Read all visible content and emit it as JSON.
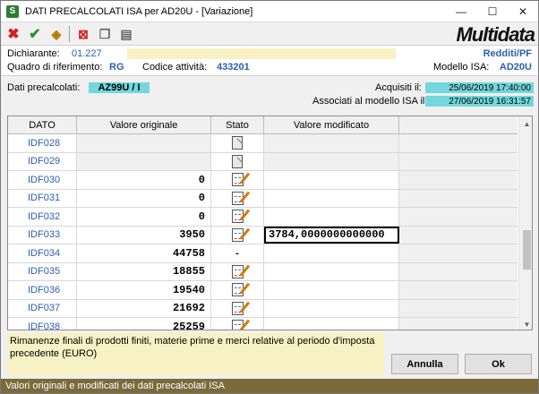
{
  "window": {
    "title": "DATI PRECALCOLATI ISA per AD20U - [Variazione]",
    "app_icon_letter": "S",
    "minimize": "—",
    "maximize": "☐",
    "close": "✕"
  },
  "toolbar": {
    "logo": "Multidata"
  },
  "header": {
    "dichiarante_label": "Dichiarante:",
    "dichiarante_value": "01.227",
    "redditi_value": "Redditi/PF",
    "quadro_label": "Quadro di riferimento:",
    "quadro_value": "RG",
    "codice_label": "Codice attività:",
    "codice_value": "433201",
    "modello_label": "Modello ISA:",
    "modello_value": "AD20U"
  },
  "info": {
    "dati_label": "Dati precalcolati:",
    "dati_value": "AZ99U  /  I",
    "acquisiti_label": "Acquisiti il:",
    "acquisiti_value": "25/06/2019  17:40:00",
    "associati_label": "Associati al modello ISA il:",
    "associati_value": "27/06/2019  16:31:57"
  },
  "grid": {
    "columns": [
      "DATO",
      "Valore originale",
      "Stato",
      "Valore modificato"
    ],
    "rows": [
      {
        "dato": "IDF028",
        "orig": "",
        "stato": "doc",
        "mod": ""
      },
      {
        "dato": "IDF029",
        "orig": "",
        "stato": "doc",
        "mod": ""
      },
      {
        "dato": "IDF030",
        "orig": "0",
        "stato": "edit",
        "mod": ""
      },
      {
        "dato": "IDF031",
        "orig": "0",
        "stato": "edit",
        "mod": ""
      },
      {
        "dato": "IDF032",
        "orig": "0",
        "stato": "edit",
        "mod": ""
      },
      {
        "dato": "IDF033",
        "orig": "3950",
        "stato": "edit",
        "mod": "3784,0000000000000"
      },
      {
        "dato": "IDF034",
        "orig": "44758",
        "stato": "-",
        "mod": ""
      },
      {
        "dato": "IDF035",
        "orig": "18855",
        "stato": "edit",
        "mod": ""
      },
      {
        "dato": "IDF036",
        "orig": "19540",
        "stato": "edit",
        "mod": ""
      },
      {
        "dato": "IDF037",
        "orig": "21692",
        "stato": "edit",
        "mod": ""
      },
      {
        "dato": "IDF038",
        "orig": "25259",
        "stato": "edit",
        "mod": ""
      }
    ]
  },
  "description": "Rimanenze finali di prodotti finiti, materie prime e merci relative al periodo d'imposta precedente (EURO)",
  "buttons": {
    "annulla": "Annulla",
    "ok": "Ok"
  },
  "status_bar": "Valori originali e modificati dei dati precalcolati ISA"
}
